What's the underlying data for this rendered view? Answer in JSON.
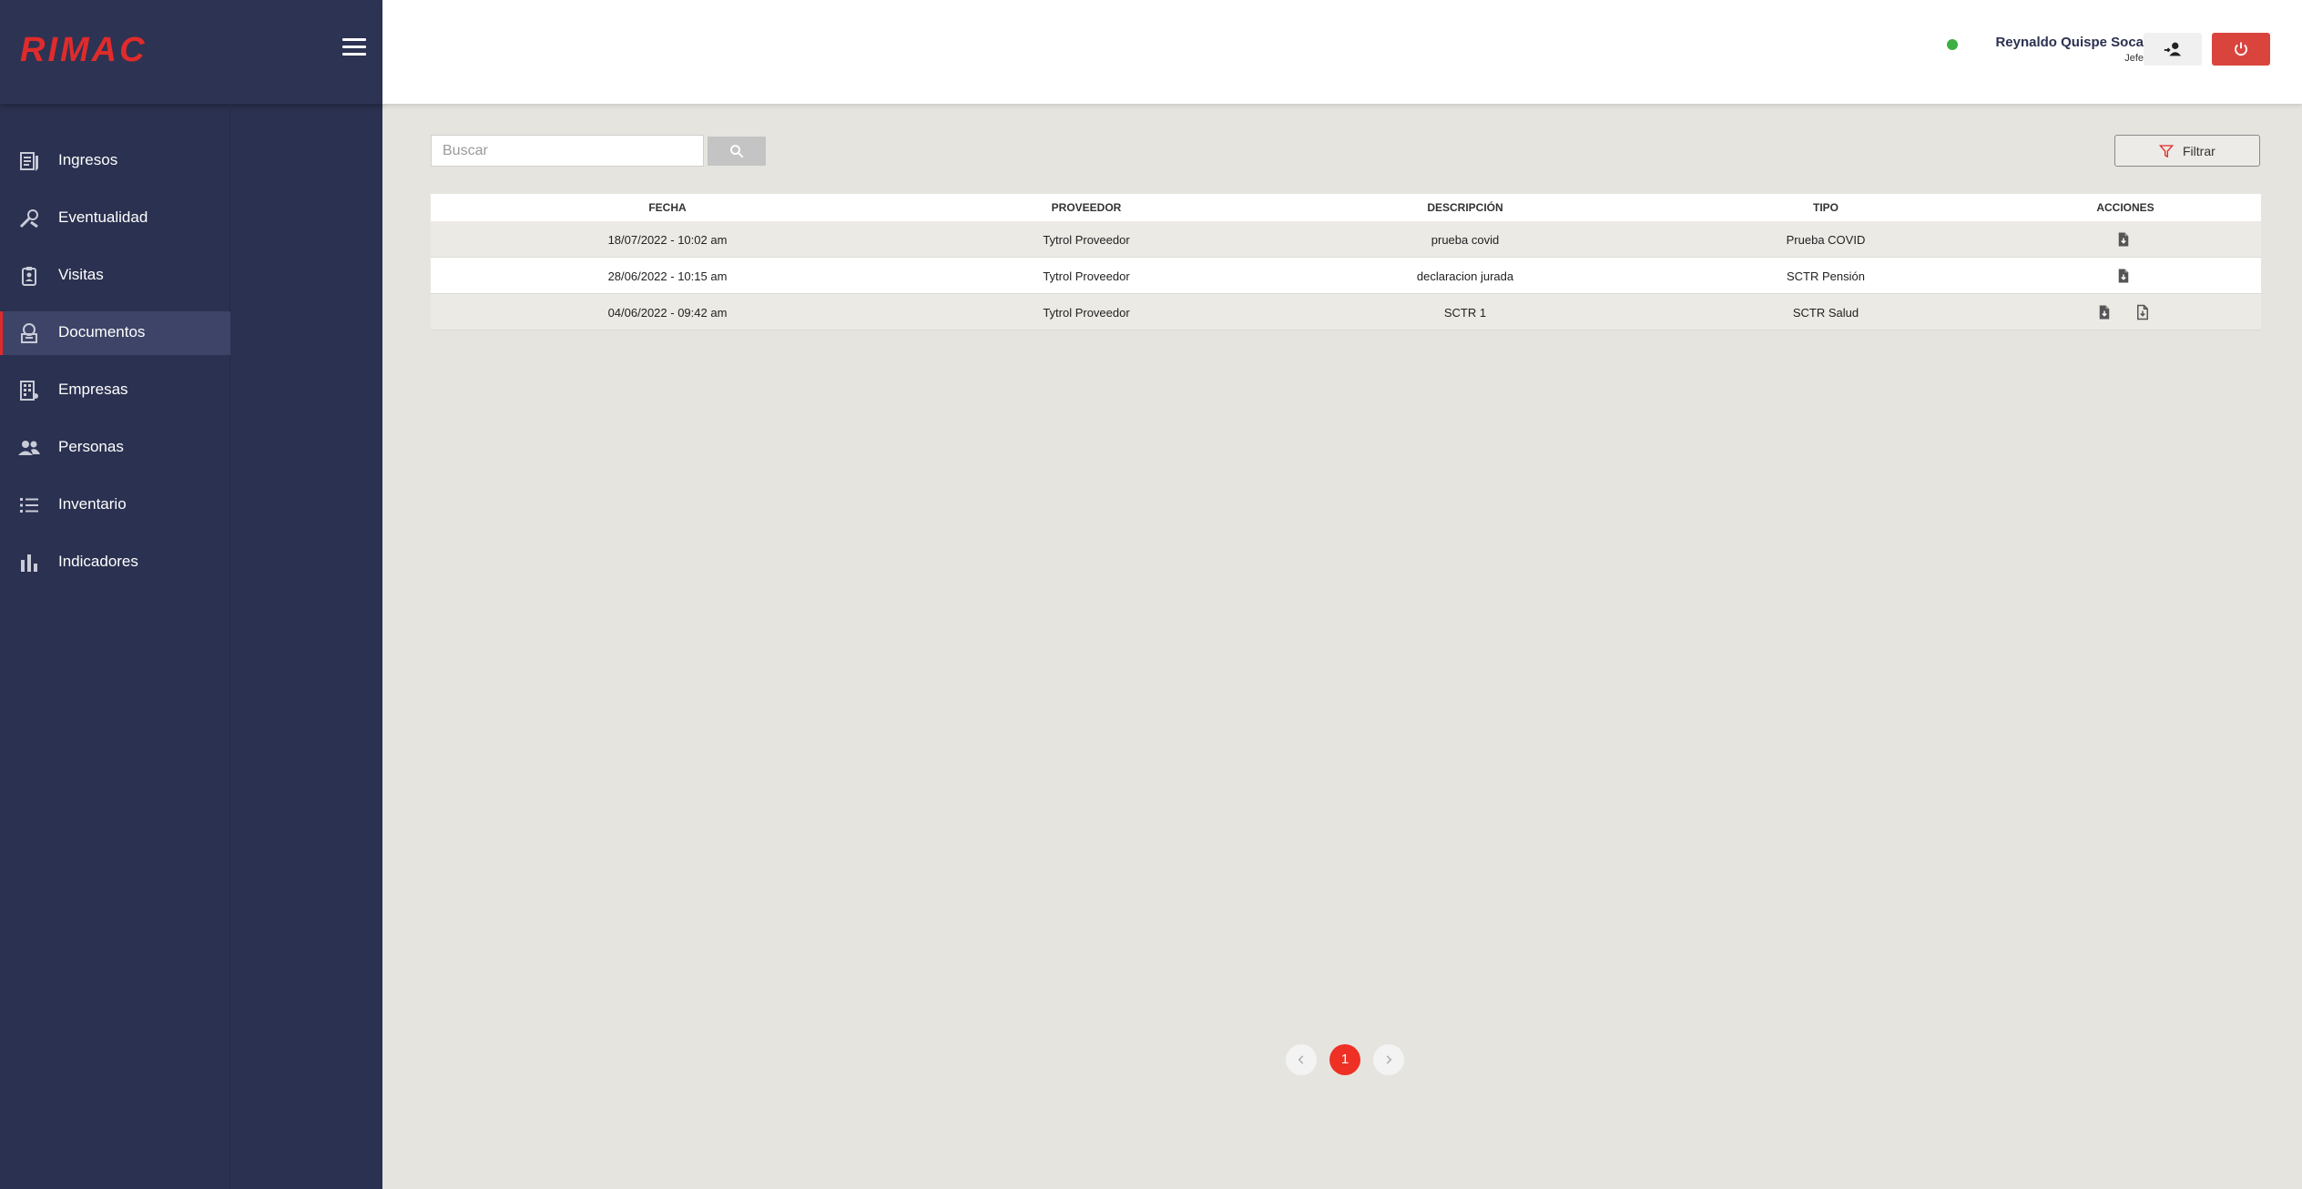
{
  "sidebar": {
    "logo": "RIMAC",
    "items": [
      {
        "label": "Ingresos",
        "icon": "clipboard-list-icon"
      },
      {
        "label": "Eventualidad",
        "icon": "tools-icon"
      },
      {
        "label": "Visitas",
        "icon": "badge-icon"
      },
      {
        "label": "Documentos",
        "icon": "documents-icon",
        "active": true
      },
      {
        "label": "Empresas",
        "icon": "building-icon"
      },
      {
        "label": "Personas",
        "icon": "people-icon"
      },
      {
        "label": "Inventario",
        "icon": "list-icon"
      },
      {
        "label": "Indicadores",
        "icon": "bar-chart-icon"
      }
    ]
  },
  "header": {
    "user_name": "Reynaldo Quispe Soca",
    "user_role": "Jefe",
    "status_color": "#3cb043"
  },
  "search": {
    "placeholder": "Buscar",
    "value": ""
  },
  "filter": {
    "label": "Filtrar"
  },
  "table": {
    "columns": [
      "FECHA",
      "PROVEEDOR",
      "DESCRIPCIÓN",
      "TIPO",
      "ACCIONES"
    ],
    "rows": [
      {
        "fecha": "18/07/2022 - 10:02 am",
        "proveedor": "Tytrol Proveedor",
        "descripcion": "prueba covid",
        "tipo": "Prueba COVID",
        "acciones": [
          "file-icon"
        ]
      },
      {
        "fecha": "28/06/2022 - 10:15 am",
        "proveedor": "Tytrol Proveedor",
        "descripcion": "declaracion jurada",
        "tipo": "SCTR Pensión",
        "acciones": [
          "file-icon"
        ]
      },
      {
        "fecha": "04/06/2022 - 09:42 am",
        "proveedor": "Tytrol Proveedor",
        "descripcion": "SCTR 1",
        "tipo": "SCTR Salud",
        "acciones": [
          "file-icon",
          "file-outline-icon"
        ]
      }
    ]
  },
  "pagination": {
    "current_page": "1"
  },
  "colors": {
    "sidebar_bg": "#2b3150",
    "brand_red": "#e02b2b",
    "power_button": "#d9453d",
    "page_active": "#ee3124"
  }
}
